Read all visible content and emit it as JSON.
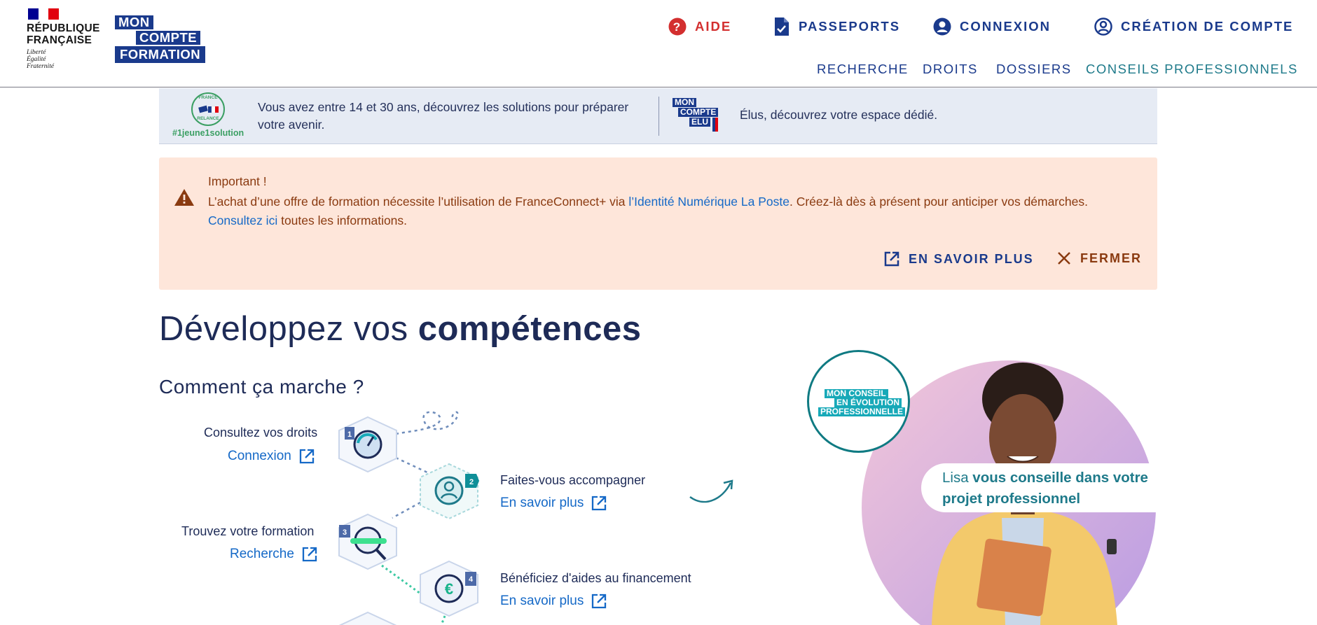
{
  "header": {
    "rf_name_line1": "RÉPUBLIQUE",
    "rf_name_line2": "FRANÇAISE",
    "rf_motto_1": "Liberté",
    "rf_motto_2": "Égalité",
    "rf_motto_3": "Fraternité",
    "logo_line1": "MON",
    "logo_line2": "COMPTE",
    "logo_line3": "FORMATION",
    "top_nav": {
      "aide": "AIDE",
      "passeports": "PASSEPORTS",
      "connexion": "CONNEXION",
      "creation": "CRÉATION DE COMPTE"
    },
    "sub_nav": {
      "recherche": "RECHERCHE",
      "droits": "DROITS",
      "dossiers": "DOSSIERS",
      "conseils": "CONSEILS PROFESSIONNELS"
    }
  },
  "banner": {
    "badge_top": "FRANCE",
    "badge_bottom": "RELANCE",
    "tag": "#1jeune1solution",
    "text_youth": "Vous avez entre 14 et 30 ans, découvrez les solutions pour préparer votre avenir.",
    "elu_line1": "MON",
    "elu_line2": "COMPTE",
    "elu_line3": "ELU",
    "text_elus": "Élus, découvrez votre espace dédié."
  },
  "alert": {
    "title": "Important !",
    "body_part1": "L’achat d’une offre de formation nécessite l’utilisation de FranceConnect+ via ",
    "body_link": "l’Identité Numérique La Poste",
    "body_part2": ". Créez-là dès à présent pour anticiper vos démarches.",
    "consult_link": "Consultez ici",
    "consult_rest": " toutes les informations.",
    "more_button": "EN SAVOIR PLUS",
    "close_button": "FERMER"
  },
  "main": {
    "title_regular": "Développez vos ",
    "title_bold": "compétences",
    "subtitle": "Comment ça marche ?",
    "steps": [
      {
        "number": "1",
        "label": "Consultez vos droits",
        "link": "Connexion"
      },
      {
        "number": "2",
        "label": "Faites-vous accompagner",
        "link": "En savoir plus"
      },
      {
        "number": "3",
        "label": "Trouvez votre formation",
        "link": "Recherche"
      },
      {
        "number": "4",
        "label": "Bénéficiez d'aides au financement",
        "link": "En savoir plus"
      }
    ],
    "step_euro_symbol": "€"
  },
  "visual": {
    "badge_line1": "MON CONSEIL",
    "badge_line2": "EN ÉVOLUTION",
    "badge_line3": "PROFESSIONNELLE",
    "quote_name": "Lisa",
    "quote_rest": " vous conseille dans votre projet professionnel"
  },
  "colors": {
    "primary_blue": "#1a3a8c",
    "teal": "#1e7a8a",
    "link_blue": "#1569c7",
    "alert_bg": "#fee6da",
    "alert_text": "#8a3a10",
    "banner_bg": "#e6ebf4",
    "aide_red": "#d32f2f"
  }
}
